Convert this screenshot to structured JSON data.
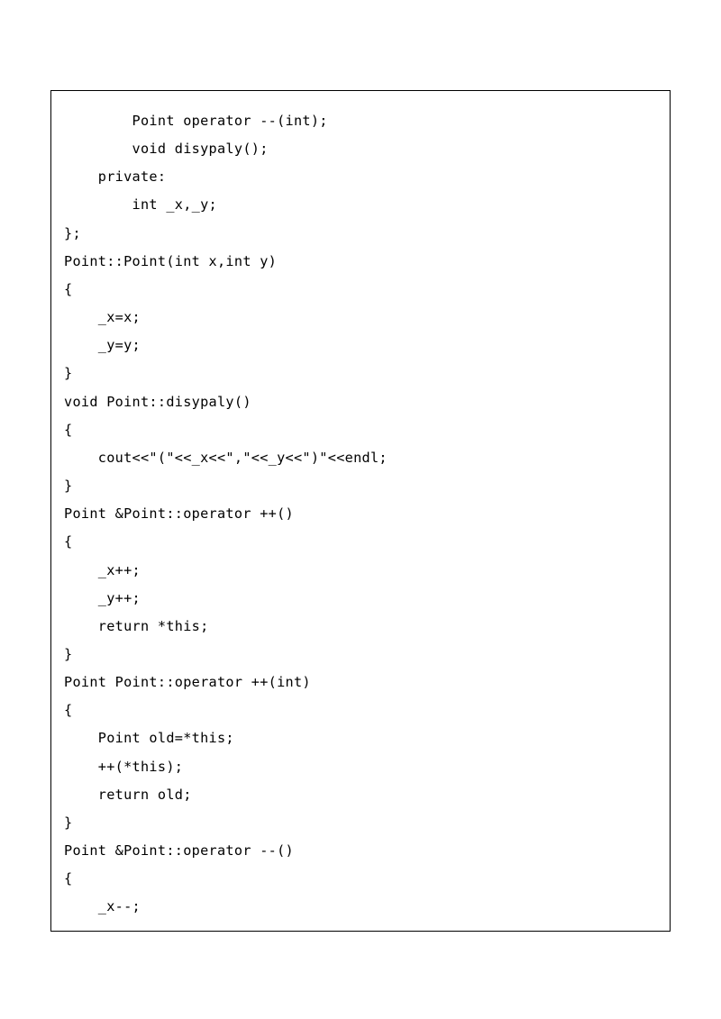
{
  "code": {
    "lines": [
      "        Point operator --(int);",
      "        void disypaly();",
      "    private:",
      "        int _x,_y;",
      "};",
      "",
      "Point::Point(int x,int y)",
      "{",
      "    _x=x;",
      "    _y=y;",
      "",
      "}",
      "void Point::disypaly()",
      "{",
      "    cout<<\"(\"<<_x<<\",\"<<_y<<\")\"<<endl;",
      "}",
      "Point &Point::operator ++()",
      "{",
      "    _x++;",
      "    _y++;",
      "    return *this;",
      "}",
      "Point Point::operator ++(int)",
      "{",
      "    Point old=*this;",
      "    ++(*this);",
      "    return old;",
      "}",
      "",
      "Point &Point::operator --()",
      "{",
      "    _x--;"
    ]
  }
}
